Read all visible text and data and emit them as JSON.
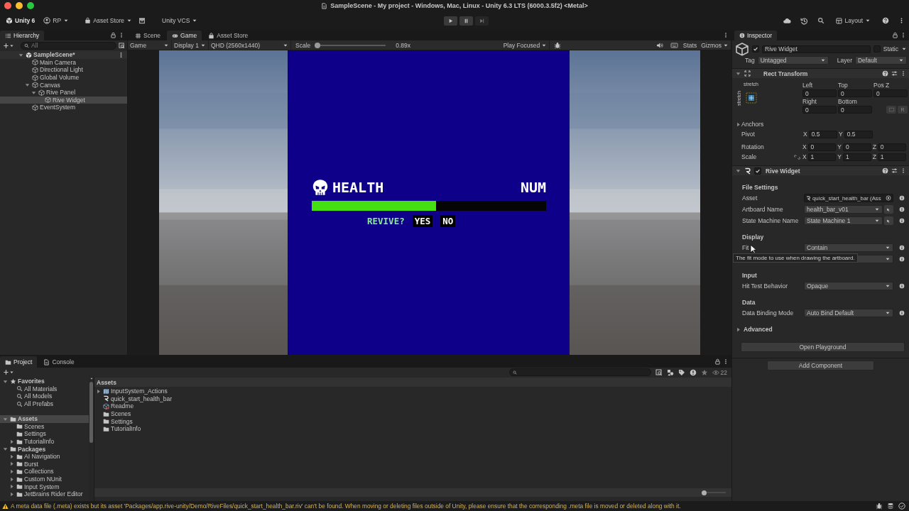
{
  "window": {
    "title": "SampleScene - My project - Windows, Mac, Linux - Unity 6.3 LTS (6000.3.5f2) <Metal>"
  },
  "toolbar": {
    "product": "Unity 6",
    "account": "RP",
    "store": "Asset Store",
    "vcs": "Unity VCS",
    "layout": "Layout"
  },
  "hierarchy": {
    "title": "Hierarchy",
    "search": {
      "placeholder": "All"
    },
    "items": [
      {
        "name": "SampleScene*",
        "kind": "scene",
        "selected": false,
        "expanded": true,
        "children": [
          {
            "name": "Main Camera",
            "kind": "object",
            "selected": false
          },
          {
            "name": "Directional Light",
            "kind": "object",
            "selected": false
          },
          {
            "name": "Global Volume",
            "kind": "object",
            "selected": false
          },
          {
            "name": "Canvas",
            "kind": "object",
            "selected": false,
            "expanded": true,
            "children": [
              {
                "name": "Rive Panel",
                "kind": "object",
                "selected": false,
                "expanded": true,
                "children": [
                  {
                    "name": "Rive Widget",
                    "kind": "object",
                    "selected": true
                  }
                ]
              }
            ]
          },
          {
            "name": "EventSystem",
            "kind": "object",
            "selected": false
          }
        ]
      }
    ]
  },
  "view_tabs": [
    {
      "label": "Scene",
      "kind": "scene",
      "selected": false
    },
    {
      "label": "Game",
      "kind": "game",
      "selected": true
    },
    {
      "label": "Asset Store",
      "kind": "store",
      "selected": false
    }
  ],
  "game_toolbar": {
    "view": "Game",
    "display": "Display 1",
    "resolution": "QHD (2560x1440)",
    "scale_label": "Scale",
    "scale": {
      "level": 0.0
    },
    "scale_value": "0.89x",
    "play_mode": "Play Focused",
    "stats": "Stats",
    "gizmos": "Gizmos"
  },
  "game": {
    "heading": "HEALTH",
    "reading": "NUM",
    "health": {
      "level": 0.53
    },
    "prompt": "REVIVE?",
    "choices": [
      "YES",
      "NO"
    ]
  },
  "inspector": {
    "title": "Inspector",
    "object": {
      "active": true,
      "name": "Rive Widget",
      "static": false,
      "static_label": "Static",
      "tag_label": "Tag",
      "tag": "Untagged",
      "layer_label": "Layer",
      "layer": "Default"
    },
    "rect_transform": {
      "title": "Rect Transform",
      "expanded": true,
      "preset": "stretch",
      "preset_vertical": "stretch",
      "edges": [
        {
          "label": "Left",
          "value": "0"
        },
        {
          "label": "Top",
          "value": "0"
        },
        {
          "label": "Pos Z",
          "value": "0"
        },
        {
          "label": "Right",
          "value": "0"
        },
        {
          "label": "Bottom",
          "value": "0"
        }
      ],
      "raw_edit": "R",
      "anchors": {
        "label": "Anchors",
        "expanded": false
      },
      "vectors": [
        {
          "label": "Pivot",
          "values": [
            {
              "axis": "X",
              "value": "0.5"
            },
            {
              "axis": "Y",
              "value": "0.5"
            }
          ]
        },
        {
          "label": "Rotation",
          "values": [
            {
              "axis": "X",
              "value": "0"
            },
            {
              "axis": "Y",
              "value": "0"
            },
            {
              "axis": "Z",
              "value": "0"
            }
          ]
        },
        {
          "label": "Scale",
          "constrained": false,
          "values": [
            {
              "axis": "X",
              "value": "1"
            },
            {
              "axis": "Y",
              "value": "1"
            },
            {
              "axis": "Z",
              "value": "1"
            }
          ]
        }
      ]
    },
    "rive_widget": {
      "title": "Rive Widget",
      "expanded": true,
      "enabled": true,
      "sections": [
        {
          "heading": "File Settings",
          "rows": [
            {
              "kind": "object",
              "label": "Asset",
              "value": "quick_start_health_bar (Ass"
            },
            {
              "kind": "picker",
              "label": "Artboard Name",
              "value": "health_bar_v01"
            },
            {
              "kind": "picker",
              "label": "State Machine Name",
              "value": "State Machine 1"
            }
          ]
        },
        {
          "heading": "Display",
          "rows": [
            {
              "kind": "dropdown",
              "label": "Fit",
              "value": "Contain"
            },
            {
              "kind": "dropdown"
            }
          ]
        },
        {
          "heading": "Input",
          "rows": [
            {
              "kind": "dropdown",
              "label": "Hit Test Behavior",
              "value": "Opaque"
            }
          ]
        },
        {
          "heading": "Data",
          "rows": [
            {
              "kind": "dropdown",
              "label": "Data Binding Mode",
              "value": "Auto Bind Default"
            }
          ]
        }
      ],
      "advanced": {
        "label": "Advanced",
        "expanded": false
      },
      "playground_button": "Open Playground"
    },
    "tooltip": "The fit mode to use when drawing the artboard.",
    "add_component": "Add Component"
  },
  "project": {
    "tabs": [
      {
        "label": "Project",
        "kind": "project",
        "selected": true
      },
      {
        "label": "Console",
        "kind": "console",
        "selected": false
      }
    ],
    "hidden_count": "22",
    "tree": [
      {
        "name": "Favorites",
        "kind": "favorites",
        "selected": false,
        "expanded": true,
        "children": [
          {
            "name": "All Materials",
            "kind": "search",
            "selected": false
          },
          {
            "name": "All Models",
            "kind": "search",
            "selected": false
          },
          {
            "name": "All Prefabs",
            "kind": "search",
            "selected": false
          }
        ]
      },
      {
        "name": "Assets",
        "kind": "folder",
        "selected": true,
        "expanded": true,
        "children": [
          {
            "name": "Scenes",
            "kind": "folder",
            "selected": false
          },
          {
            "name": "Settings",
            "kind": "folder",
            "selected": false
          },
          {
            "name": "TutorialInfo",
            "kind": "folder",
            "selected": false,
            "expanded": false
          }
        ]
      },
      {
        "name": "Packages",
        "kind": "folder",
        "selected": false,
        "expanded": true,
        "children": [
          {
            "name": "AI Navigation",
            "kind": "folder",
            "selected": false,
            "expanded": false
          },
          {
            "name": "Burst",
            "kind": "folder",
            "selected": false,
            "expanded": false
          },
          {
            "name": "Collections",
            "kind": "folder",
            "selected": false,
            "expanded": false
          },
          {
            "name": "Custom NUnit",
            "kind": "folder",
            "selected": false,
            "expanded": false
          },
          {
            "name": "Input System",
            "kind": "folder",
            "selected": false,
            "expanded": false
          },
          {
            "name": "JetBrains Rider Editor",
            "kind": "folder",
            "selected": false,
            "expanded": false
          }
        ]
      }
    ],
    "breadcrumb": "Assets",
    "zoom": {
      "level": 0.0
    },
    "files": [
      {
        "name": "InputSystem_Actions",
        "kind": "input_actions",
        "selected": false,
        "expanded": false
      },
      {
        "name": "quick_start_health_bar",
        "kind": "rive",
        "selected": false
      },
      {
        "name": "Readme",
        "kind": "readme",
        "selected": false
      },
      {
        "name": "Scenes",
        "kind": "folder",
        "selected": false
      },
      {
        "name": "Settings",
        "kind": "folder",
        "selected": false
      },
      {
        "name": "TutorialInfo",
        "kind": "folder",
        "selected": false
      }
    ]
  },
  "status_bar": {
    "kind": "warning",
    "message": "A meta data file (.meta) exists but its asset 'Packages/app.rive-unity/Demo/RiveFiles/quick_start_health_bar.riv' can't be found. When moving or deleting files outside of Unity, please ensure that the corresponding .meta file is moved or deleted along with it."
  }
}
